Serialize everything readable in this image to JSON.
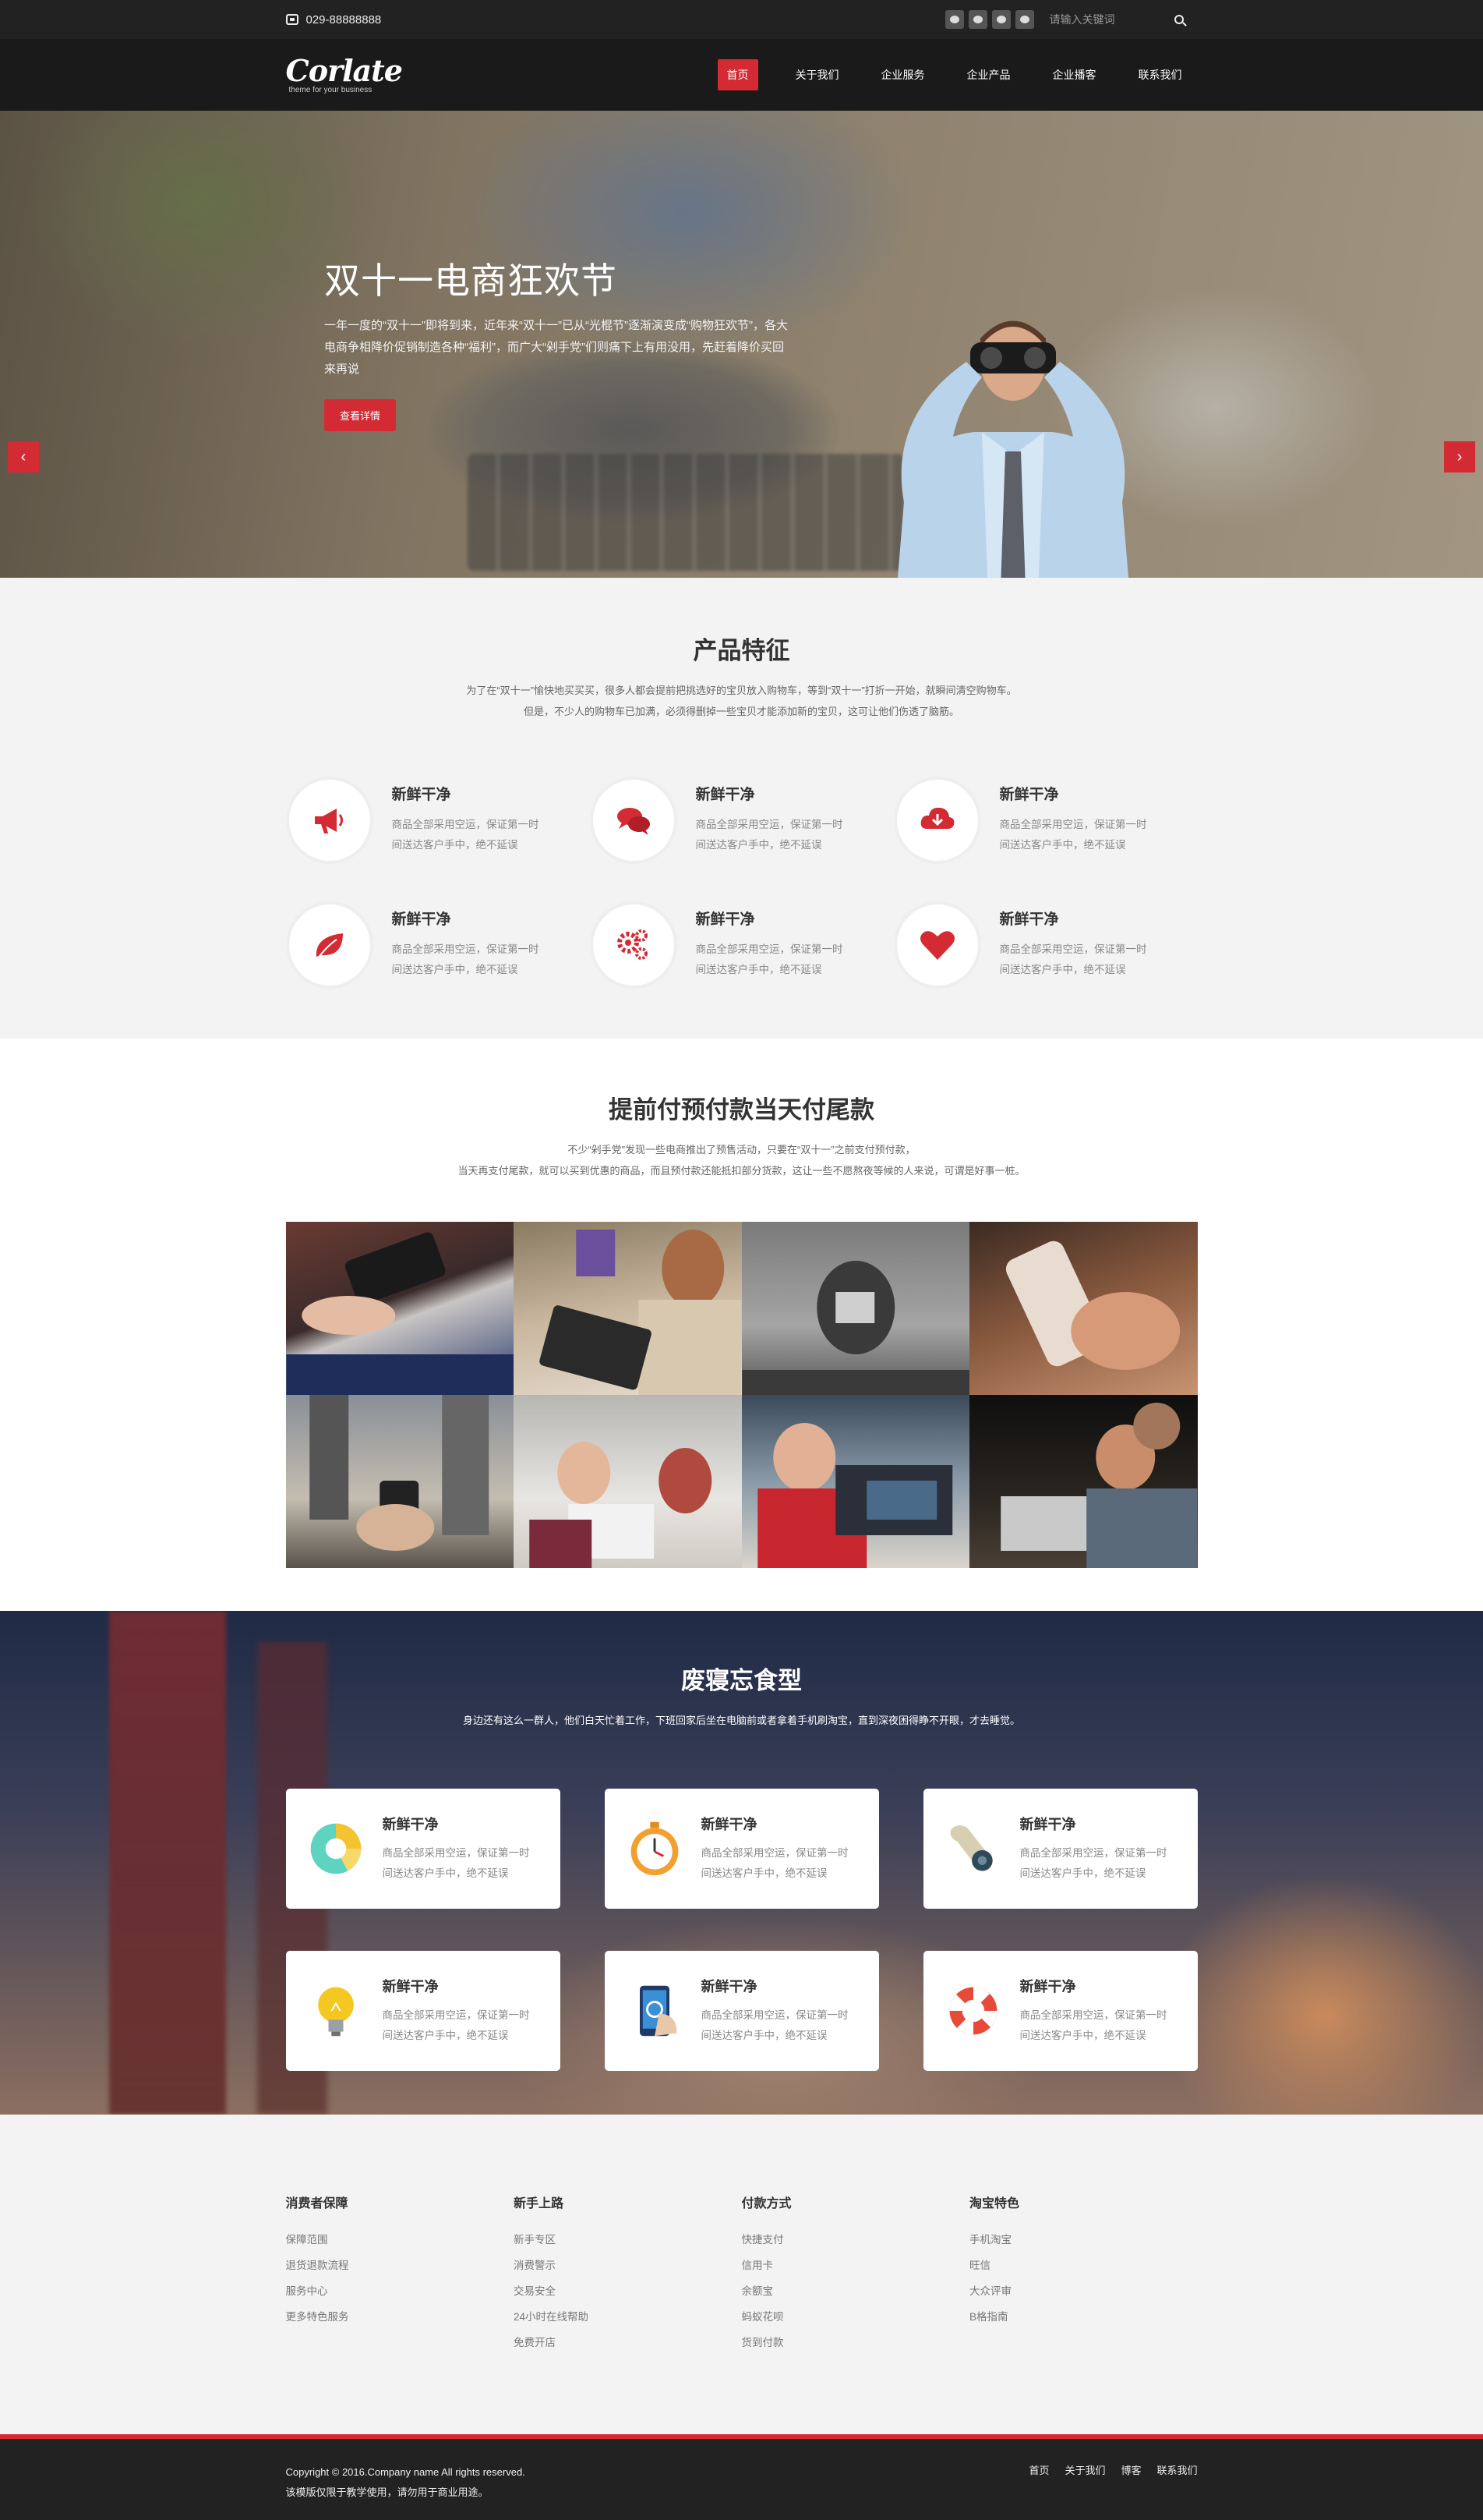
{
  "topbar": {
    "phone": "029-88888888",
    "social": [
      "weibo-icon",
      "wechat-icon",
      "qq-icon",
      "tencent-icon"
    ],
    "search_placeholder": "请输入关键词"
  },
  "nav": {
    "logo": "Corlate",
    "tagline": "theme for your business",
    "items": [
      "首页",
      "关于我们",
      "企业服务",
      "企业产品",
      "企业播客",
      "联系我们"
    ],
    "active": "首页"
  },
  "hero": {
    "title": "双十一电商狂欢节",
    "text": "一年一度的“双十一”即将到来，近年来“双十一”已从“光棍节”逐渐演变成“购物狂欢节”，各大电商争相降价促销制造各种“福利”，而广大“剁手党”们则痛下上有用没用，先赶着降价买回来再说",
    "button": "查看详情",
    "prev": "‹",
    "next": "›",
    "slides": 3,
    "active_slide": 1
  },
  "features": {
    "title": "产品特征",
    "sub1": "为了在“双十一”愉快地买买买，很多人都会提前把挑选好的宝贝放入购物车，等到“双十一”打折一开始，就瞬间清空购物车。",
    "sub2": "但是，不少人的购物车已加满，必须得删掉一些宝贝才能添加新的宝贝，这可让他们伤透了脑筋。",
    "items": [
      {
        "icon": "megaphone-icon",
        "title": "新鲜干净",
        "line1": "商品全部采用空运，保证第一时",
        "line2": "间送达客户手中，绝不延误"
      },
      {
        "icon": "chat-icon",
        "title": "新鲜干净",
        "line1": "商品全部采用空运，保证第一时",
        "line2": "间送达客户手中，绝不延误"
      },
      {
        "icon": "cloud-download-icon",
        "title": "新鲜干净",
        "line1": "商品全部采用空运，保证第一时",
        "line2": "间送达客户手中，绝不延误"
      },
      {
        "icon": "leaf-icon",
        "title": "新鲜干净",
        "line1": "商品全部采用空运，保证第一时",
        "line2": "间送达客户手中，绝不延误"
      },
      {
        "icon": "gears-icon",
        "title": "新鲜干净",
        "line1": "商品全部采用空运，保证第一时",
        "line2": "间送达客户手中，绝不延误"
      },
      {
        "icon": "heart-icon",
        "title": "新鲜干净",
        "line1": "商品全部采用空运，保证第一时",
        "line2": "间送达客户手中，绝不延误"
      }
    ]
  },
  "gallery": {
    "title": "提前付预付款当天付尾款",
    "sub1": "不少“剁手党”发现一些电商推出了预售活动，只要在“双十一”之前支付预付款，",
    "sub2": "当天再支付尾款，就可以买到优惠的商品，而且预付款还能抵扣部分货款，这让一些不愿熬夜等候的人来说，可谓是好事一桩。"
  },
  "reviews": {
    "title": "废寝忘食型",
    "sub": "身边还有这么一群人，他们白天忙着工作，下班回家后坐在电脑前或者拿着手机刷淘宝，直到深夜困得睁不开眼，才去睡觉。",
    "items": [
      {
        "icon": "pie-chart-icon",
        "title": "新鲜干净",
        "line1": "商品全部采用空运，保证第一时",
        "line2": "间送达客户手中，绝不延误"
      },
      {
        "icon": "stopwatch-icon",
        "title": "新鲜干净",
        "line1": "商品全部采用空运，保证第一时",
        "line2": "间送达客户手中，绝不延误"
      },
      {
        "icon": "wrench-icon",
        "title": "新鲜干净",
        "line1": "商品全部采用空运，保证第一时",
        "line2": "间送达客户手中，绝不延误"
      },
      {
        "icon": "lightbulb-icon",
        "title": "新鲜干净",
        "line1": "商品全部采用空运，保证第一时",
        "line2": "间送达客户手中，绝不延误"
      },
      {
        "icon": "mobile-touch-icon",
        "title": "新鲜干净",
        "line1": "商品全部采用空运，保证第一时",
        "line2": "间送达客户手中，绝不延误"
      },
      {
        "icon": "lifebuoy-icon",
        "title": "新鲜干净",
        "line1": "商品全部采用空运，保证第一时",
        "line2": "间送达客户手中，绝不延误"
      }
    ]
  },
  "footer": {
    "columns": [
      {
        "title": "消费者保障",
        "links": [
          "保障范围",
          "退货退款流程",
          "服务中心",
          "更多特色服务"
        ]
      },
      {
        "title": "新手上路",
        "links": [
          "新手专区",
          "消费警示",
          "交易安全",
          "24小时在线帮助",
          "免费开店"
        ]
      },
      {
        "title": "付款方式",
        "links": [
          "快捷支付",
          "信用卡",
          "余额宝",
          "蚂蚁花呗",
          "货到付款"
        ]
      },
      {
        "title": "淘宝特色",
        "links": [
          "手机淘宝",
          "旺信",
          "大众评审",
          "B格指南"
        ]
      }
    ],
    "copyright": "Copyright © 2016.Company name All rights reserved.",
    "notice": "该模版仅限于教学使用，请勿用于商业用途。",
    "bottom_nav": [
      "首页",
      "关于我们",
      "博客",
      "联系我们"
    ]
  },
  "colors": {
    "accent": "#d42a33",
    "dark": "#222222"
  }
}
